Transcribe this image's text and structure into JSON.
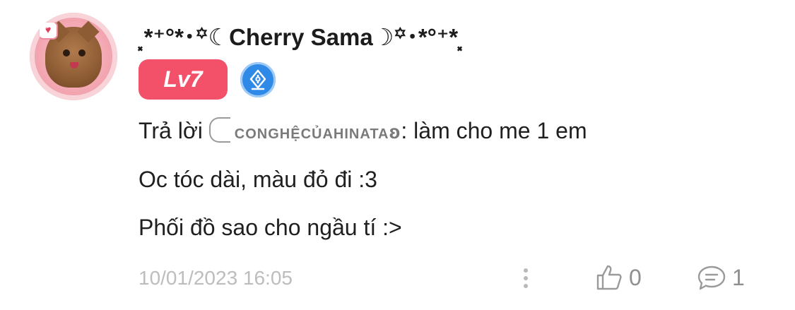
{
  "user": {
    "display_name": "⸼*⁺°*･꙳☾Cherry Sama☽꙳･*°⁺*⸼",
    "level": "Lv7",
    "badge_icon": "fountain-pen-icon"
  },
  "comment": {
    "reply_prefix": "Trả lời",
    "mention": "conghệcủahinata",
    "mention_suffix": "ʚ",
    "reply_text": ": làm cho me 1 em",
    "line2": "Oc tóc dài, màu đỏ đi :3",
    "line3": "Phối đồ sao cho ngầu tí :>"
  },
  "footer": {
    "timestamp": "10/01/2023 16:05",
    "like_count": "0",
    "reply_count": "1"
  },
  "colors": {
    "level_badge": "#f3506a",
    "pen_badge": "#2e8ae6",
    "timestamp": "#bdbdbd",
    "counts": "#8f8f8f"
  }
}
